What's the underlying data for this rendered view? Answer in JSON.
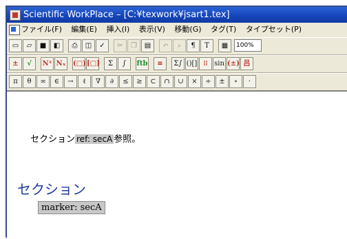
{
  "window": {
    "title": "Scientific WorkPlace – [C:¥texwork¥jsart1.tex]"
  },
  "menu": [
    "ファイル(F)",
    "編集(E)",
    "挿入(I)",
    "表示(V)",
    "移動(G)",
    "タグ(T)",
    "タイプセット(P)"
  ],
  "toolbar1": {
    "zoom_value": "100%",
    "buttons": [
      "new-icon",
      "open-icon",
      "save-icon",
      "save-all-icon",
      "print-icon",
      "preview-icon",
      "spellcheck-icon",
      "cut-icon",
      "copy-icon",
      "paste-icon",
      "undo-icon",
      "find-icon",
      "paragraph-icon",
      "text-icon",
      "table-icon"
    ]
  },
  "toolbar2": {
    "labels": [
      "±",
      "√",
      "Nˣ",
      "Nₓ",
      "(□)",
      "[□]",
      "Σ",
      "∫",
      "ftb",
      "≡",
      "Σ∫",
      "()[]",
      "⁝⁝",
      "sin cos",
      "(±)",
      "吕"
    ]
  },
  "toolbar3": {
    "symbols": [
      "π",
      "θ",
      "∞",
      "∈",
      "→",
      "ℓ",
      "∇",
      "∂",
      "≤",
      "≥",
      "⊂",
      "∩",
      "∪",
      "×",
      "÷",
      "±",
      "∘",
      "·"
    ]
  },
  "document": {
    "line1_prefix": "セクション",
    "ref_text": "ref: secA",
    "line1_suffix": "参照。",
    "section_heading": "セクション",
    "marker_text": "marker: secA"
  }
}
